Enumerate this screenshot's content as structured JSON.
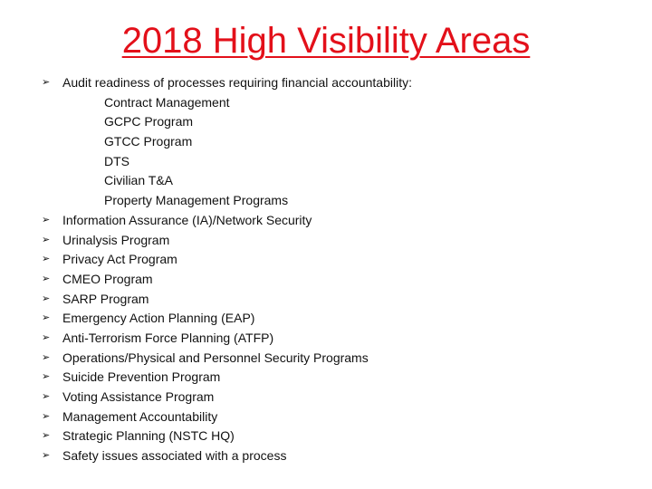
{
  "title": "2018 High Visibility Areas",
  "bullet_glyph": "➢",
  "items": [
    {
      "text": "Audit readiness of processes requiring financial accountability:",
      "bullet": true
    },
    {
      "text": "Contract Management",
      "bullet": false
    },
    {
      "text": "GCPC Program",
      "bullet": false
    },
    {
      "text": "GTCC Program",
      "bullet": false
    },
    {
      "text": "DTS",
      "bullet": false
    },
    {
      "text": "Civilian T&A",
      "bullet": false
    },
    {
      "text": "Property Management Programs",
      "bullet": false
    },
    {
      "text": "Information Assurance (IA)/Network Security",
      "bullet": true
    },
    {
      "text": "Urinalysis Program",
      "bullet": true
    },
    {
      "text": "Privacy Act Program",
      "bullet": true
    },
    {
      "text": "CMEO Program",
      "bullet": true
    },
    {
      "text": "SARP Program",
      "bullet": true
    },
    {
      "text": "Emergency Action Planning (EAP)",
      "bullet": true
    },
    {
      "text": "Anti-Terrorism Force Planning (ATFP)",
      "bullet": true
    },
    {
      "text": "Operations/Physical and Personnel Security Programs",
      "bullet": true
    },
    {
      "text": "Suicide Prevention Program",
      "bullet": true
    },
    {
      "text": "Voting Assistance Program",
      "bullet": true
    },
    {
      "text": "Management Accountability",
      "bullet": true
    },
    {
      "text": "Strategic Planning (NSTC HQ)",
      "bullet": true
    },
    {
      "text": "Safety issues associated with a process",
      "bullet": true
    }
  ]
}
